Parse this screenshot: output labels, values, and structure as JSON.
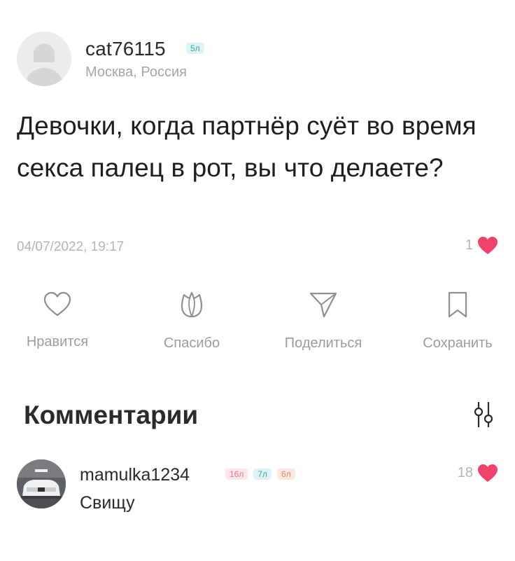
{
  "post": {
    "author": {
      "username": "cat76115",
      "badge": "5л",
      "location": "Москва, Россия"
    },
    "text": "Девочки, когда партнёр суёт во время секса палец в рот, вы что делаете?",
    "date": "04/07/2022, 19:17",
    "likes": "1"
  },
  "actions": {
    "like": "Нравится",
    "thanks": "Спасибо",
    "share": "Поделиться",
    "save": "Сохранить"
  },
  "comments": {
    "title": "Комментарии",
    "items": [
      {
        "username": "mamulka1234",
        "badges": [
          "16л",
          "7л",
          "6л"
        ],
        "text": "Свищу",
        "likes": "18"
      }
    ]
  },
  "colors": {
    "heart": "#f0436b",
    "icon_gray": "#8f8f8f",
    "muted_text": "#a6a6a6"
  }
}
